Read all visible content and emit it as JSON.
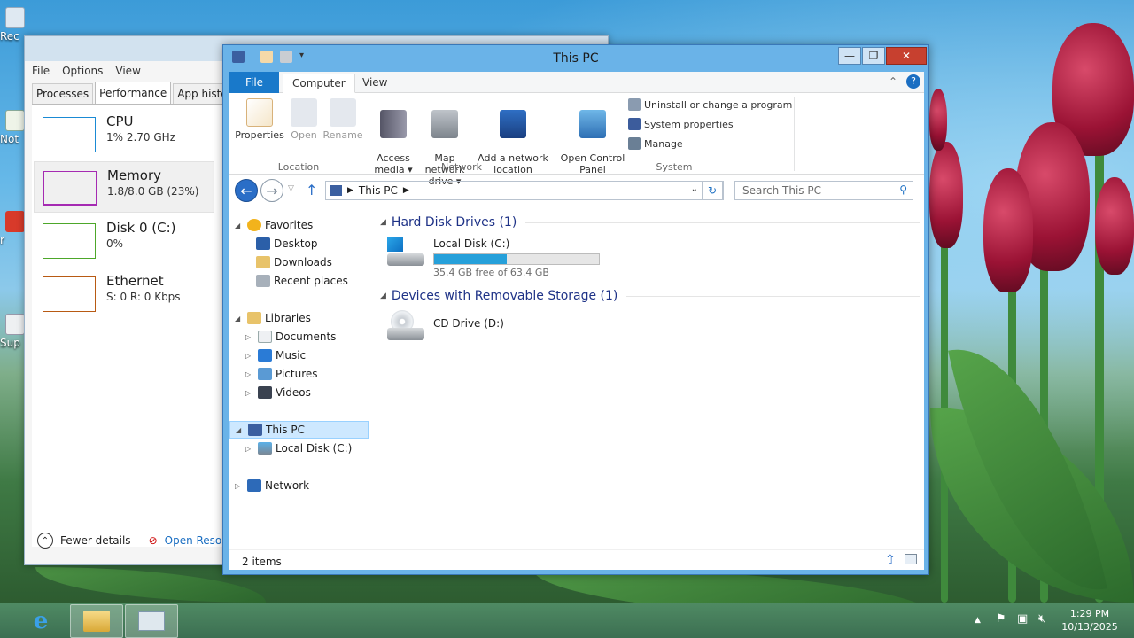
{
  "explorer": {
    "title": "This PC",
    "ribbon_tabs": [
      "File",
      "Computer",
      "View"
    ],
    "location_group": {
      "label": "Location",
      "buttons": [
        "Properties",
        "Open",
        "Rename"
      ]
    },
    "network_group": {
      "label": "Network",
      "buttons": [
        "Access\nmedia ▾",
        "Map network\ndrive ▾",
        "Add a network\nlocation"
      ]
    },
    "system_group": {
      "label": "System",
      "control_panel": "Open Control\nPanel",
      "links": [
        "Uninstall or change a program",
        "System properties",
        "Manage"
      ]
    },
    "address": {
      "crumb": "This PC"
    },
    "search": {
      "placeholder": "Search This PC"
    },
    "nav_tree": {
      "favorites": {
        "label": "Favorites",
        "items": [
          "Desktop",
          "Downloads",
          "Recent places"
        ]
      },
      "libraries": {
        "label": "Libraries",
        "items": [
          "Documents",
          "Music",
          "Pictures",
          "Videos"
        ]
      },
      "this_pc": {
        "label": "This PC",
        "items": [
          "Local Disk (C:)"
        ]
      },
      "network": {
        "label": "Network"
      }
    },
    "groups": [
      {
        "header": "Hard Disk Drives (1)",
        "drives": [
          {
            "name": "Local Disk (C:)",
            "free": "35.4 GB free of 63.4 GB",
            "used_fraction": 0.44
          }
        ]
      },
      {
        "header": "Devices with Removable Storage (1)",
        "drives": [
          {
            "name": "CD Drive (D:)"
          }
        ]
      }
    ],
    "status": "2 items"
  },
  "task_manager": {
    "menu": [
      "File",
      "Options",
      "View"
    ],
    "tabs": [
      "Processes",
      "Performance",
      "App history"
    ],
    "perf_items": [
      {
        "name": "CPU",
        "value": "1% 2.70 GHz",
        "color": "#1a8ad4"
      },
      {
        "name": "Memory",
        "value": "1.8/8.0 GB (23%)",
        "color": "#a52ab2"
      },
      {
        "name": "Disk 0 (C:)",
        "value": "0%",
        "color": "#4da72a"
      },
      {
        "name": "Ethernet",
        "value": "S: 0 R: 0 Kbps",
        "color": "#b85a13"
      }
    ],
    "fewer_details": "Fewer details",
    "open_resource": "Open Resourc"
  },
  "desktop_icons": [
    "Rec",
    "Not",
    "r",
    "Sup"
  ],
  "taskbar": {
    "clock_time": "1:29 PM",
    "clock_date": "10/13/2025"
  }
}
